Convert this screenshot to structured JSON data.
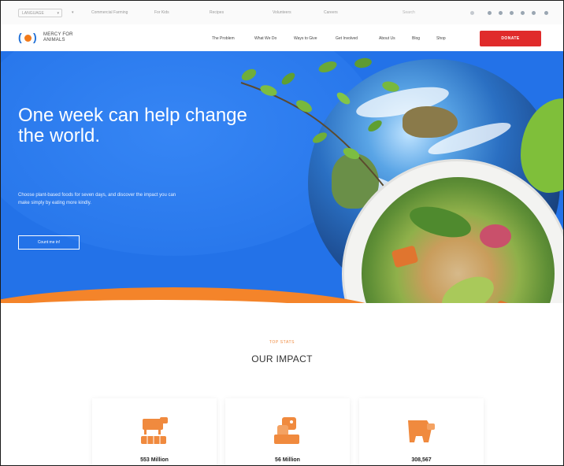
{
  "topbar": {
    "language": "LANGUAGE",
    "links": [
      "Commercial Farming",
      "For Kids",
      "Recipes",
      "Volunteers",
      "Careers"
    ],
    "search_placeholder": "Search"
  },
  "brand": {
    "name_line1": "MERCY FOR",
    "name_line2": "ANIMALS"
  },
  "nav": {
    "items": [
      "The Problem",
      "What We Do",
      "Ways to Give",
      "Get Involved",
      "About Us",
      "Blog",
      "Shop"
    ],
    "donate_label": "DONATE"
  },
  "hero": {
    "title": "One week can help change the world.",
    "subtitle": "Choose plant-based foods for seven days, and discover the impact you can make simply by eating more kindly.",
    "cta_label": "Count me in!"
  },
  "impact": {
    "eyebrow": "TOP STATS",
    "title": "OUR IMPACT",
    "stats": [
      {
        "value": "553 Million",
        "icon": "farm-animals-icon"
      },
      {
        "value": "56 Million",
        "icon": "chicken-icon"
      },
      {
        "value": "308,567",
        "icon": "pig-icon"
      }
    ]
  },
  "colors": {
    "primary_blue": "#2372e8",
    "accent_orange": "#f4842a",
    "donate_red": "#e02b2b"
  }
}
